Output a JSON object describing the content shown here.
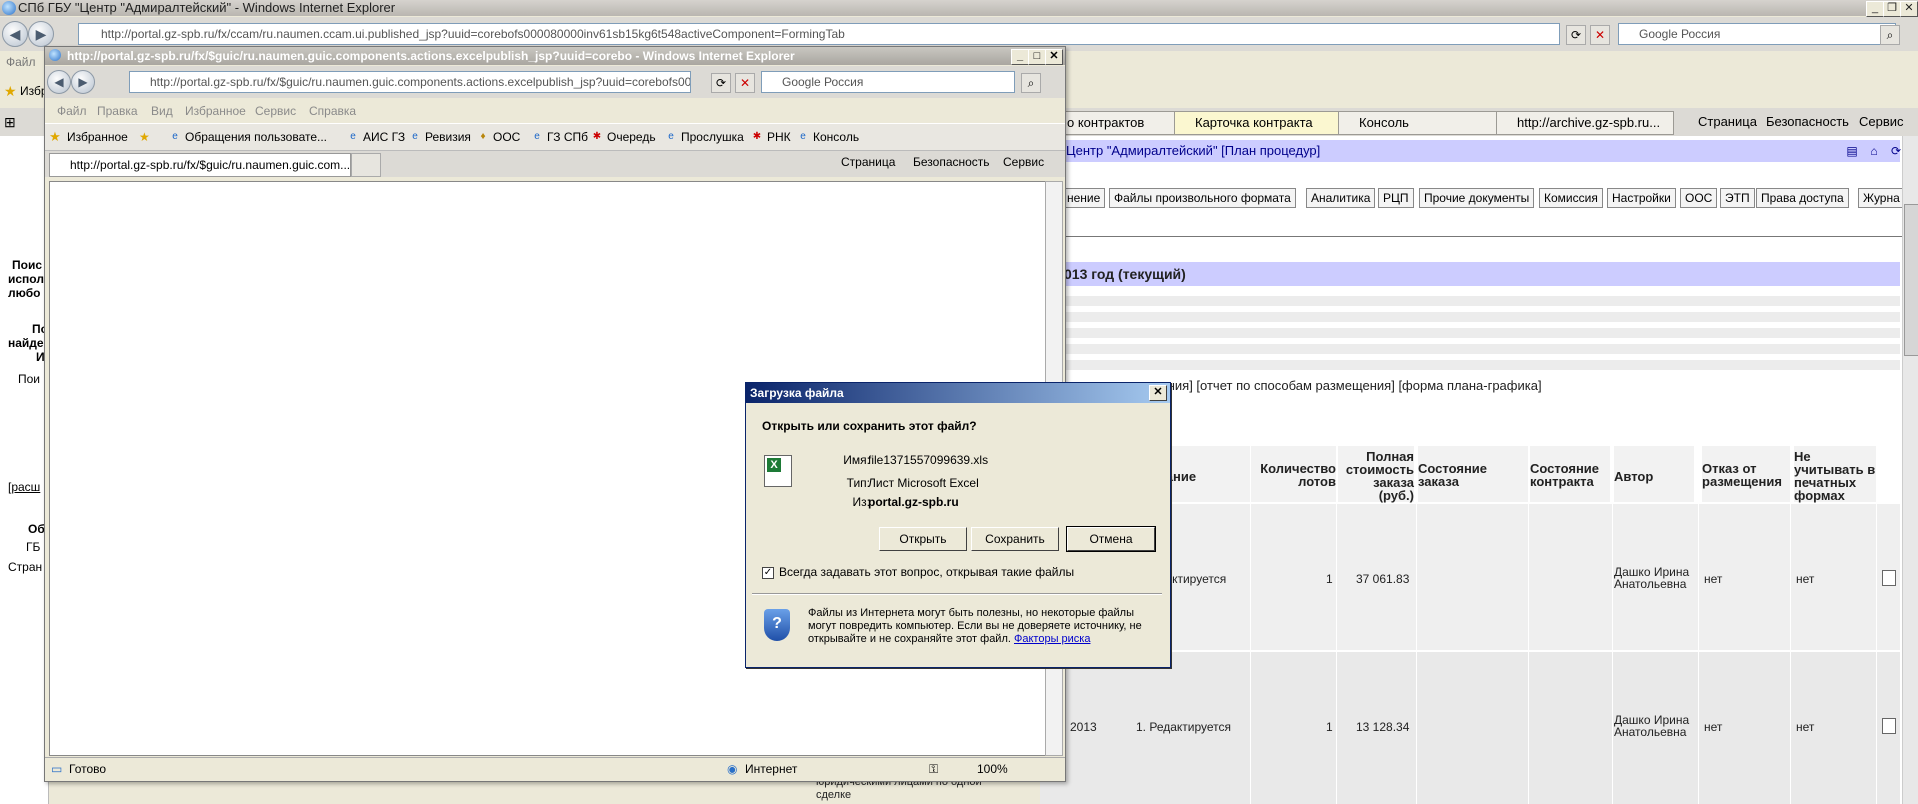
{
  "outer": {
    "title": "СПб ГБУ \"Центр \"Адмиралтейский\" - Windows Internet Explorer",
    "address": "http://portal.gz-spb.ru/fx/ccam/ru.naumen.ccam.ui.published_jsp?uuid=corebofs000080000inv61sb15kg6t548activeComponent=FormingTab",
    "search_placeholder": "Google Россия",
    "menu_file": "Файл",
    "fav_short": "Избр",
    "tabs": [
      "о контрактов",
      "Карточка контракта",
      "Консоль",
      "http://archive.gz-spb.ru..."
    ],
    "cmd": {
      "page": "Страница",
      "security": "Безопасность",
      "service": "Сервис"
    },
    "left_texts": [
      "Поис",
      "испол",
      "любо",
      "По",
      "найде",
      "И",
      "Пои",
      "[расш",
      "Об",
      "ГБ",
      "Стран"
    ],
    "header_bar": "Центр \"Адмиралтейский\" [План процедур]",
    "buttons": [
      "нение",
      "Файлы произвольного формата",
      "Аналитика",
      "РЦП",
      "Прочие документы",
      "Комиссия",
      "Настройки",
      "ООС",
      "ЭТП",
      "Права доступа",
      "Журна"
    ],
    "year_title": "013 год (текущий)",
    "links": "ирования] [отчет по способам размещения] [форма плана-графика]",
    "table": {
      "headers": [
        "ование",
        "Количество лотов",
        "Полная стоимость заказа (руб.)",
        "Состояние заказа",
        "Состояние контракта",
        "Автор",
        "Отказ от размещения",
        "Не учитывать в печатных формах"
      ],
      "rows": [
        {
          "status": "едактируется",
          "lots": "1",
          "cost": "37 061.83",
          "author": "Дашко Ирина Анатольевна",
          "refuse": "нет",
          "noprint": "нет"
        },
        {
          "year": "2013",
          "status": "1. Редактируется",
          "lots": "1",
          "cost": "13 128.34",
          "author": "Дашко Ирина Анатольевна",
          "refuse": "нет",
          "noprint": "нет"
        }
      ],
      "footnote": [
        "юридическими лицами по одной",
        "сделке"
      ]
    }
  },
  "inner": {
    "title": "http://portal.gz-spb.ru/fx/$guic/ru.naumen.guic.components.actions.excelpublish_jsp?uuid=corebo - Windows Internet Explorer",
    "address": "http://portal.gz-spb.ru/fx/$guic/ru.naumen.guic.components.actions.excelpublish_jsp?uuid=corebofs00008000",
    "search_placeholder": "Google Россия",
    "menu": [
      "Файл",
      "Правка",
      "Вид",
      "Избранное",
      "Сервис",
      "Справка"
    ],
    "favorites_label": "Избранное",
    "favorites": [
      "Обращения пользовате...",
      "АИС ГЗ",
      "Ревизия",
      "ООС",
      "ГЗ СПб",
      "Очередь",
      "Прослушка",
      "РНК",
      "Консоль"
    ],
    "tab_label": "http://portal.gz-spb.ru/fx/$guic/ru.naumen.guic.com...",
    "cmd": {
      "page": "Страница",
      "security": "Безопасность",
      "service": "Сервис"
    },
    "status_text": "Готово",
    "zone": "Интернет",
    "zoom": "100%"
  },
  "dialog": {
    "title": "Загрузка файла",
    "question": "Открыть или сохранить этот файл?",
    "name_label": "Имя:",
    "name_value": "file1371557099639.xls",
    "type_label": "Тип:",
    "type_value": "Лист Microsoft Excel",
    "from_label": "Из:",
    "from_value": "portal.gz-spb.ru",
    "open": "Открыть",
    "save": "Сохранить",
    "cancel": "Отмена",
    "always_ask": "Всегда задавать этот вопрос, открывая такие файлы",
    "warning": "Файлы из Интернета могут быть полезны, но некоторые файлы могут повредить компьютер. Если вы не доверяете источнику, не открывайте и не сохраняйте этот файл.",
    "risk_link": "Факторы риска"
  }
}
